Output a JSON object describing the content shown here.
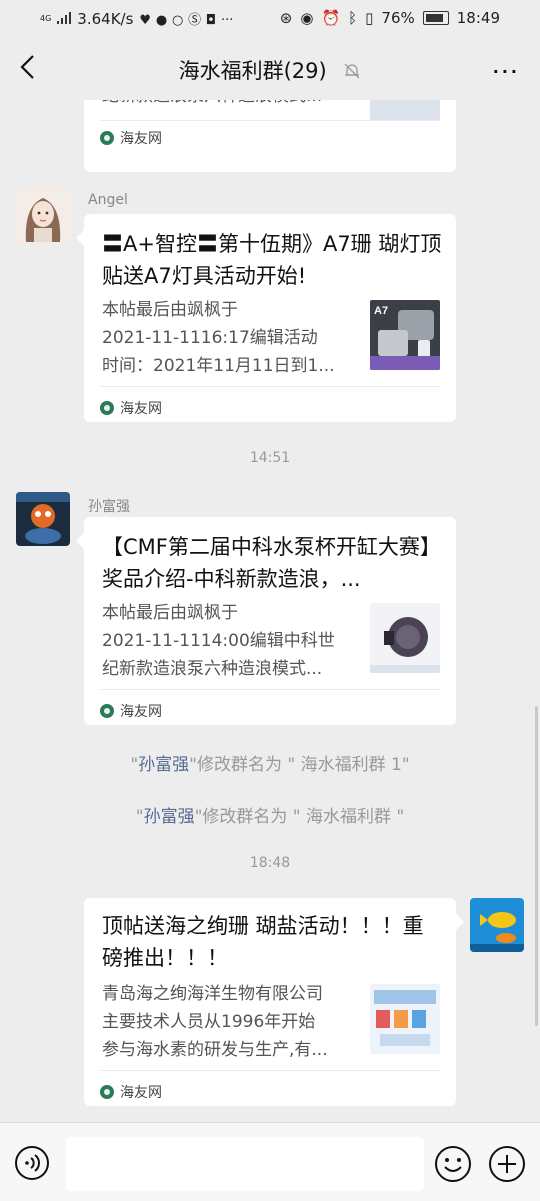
{
  "status_bar": {
    "network": "4G",
    "speed": "3.64K/s",
    "battery": "76%",
    "time": "18:49"
  },
  "header": {
    "title": "海水福利群(29)"
  },
  "messages": [
    {
      "partial_desc": "纪新款造浪泵六种造浪模式...",
      "source": "海友网"
    },
    {
      "sender": "Angel",
      "title": "〓A+智控〓第十伍期》A7珊 瑚灯顶贴送A7灯具活动开始!",
      "desc": [
        "本帖最后由飒枫于",
        "2021-11-1116:17编辑活动",
        "时间：2021年11月11日到1..."
      ],
      "thumb_label": "A7",
      "source": "海友网"
    },
    {
      "time": "14:51"
    },
    {
      "sender": "孙富强",
      "title": "【CMF第二届中科水泵杯开缸大赛】奖品介绍-中科新款造浪，...",
      "desc": [
        "本帖最后由飒枫于",
        "2021-11-1114:00编辑中科世",
        "纪新款造浪泵六种造浪模式..."
      ],
      "source": "海友网"
    },
    {
      "system": [
        "\"",
        "孙富强",
        "\"修改群名为 \" 海水福利群 1\""
      ]
    },
    {
      "system": [
        "\"",
        "孙富强",
        "\"修改群名为 \" 海水福利群 \""
      ]
    },
    {
      "time": "18:48"
    },
    {
      "title": "顶帖送海之绚珊 瑚盐活动！！！重磅推出！！！",
      "desc": [
        "青岛海之绚海洋生物有限公司",
        "主要技术人员从1996年开始",
        "参与海水素的研发与生产,有..."
      ],
      "source": "海友网"
    }
  ]
}
